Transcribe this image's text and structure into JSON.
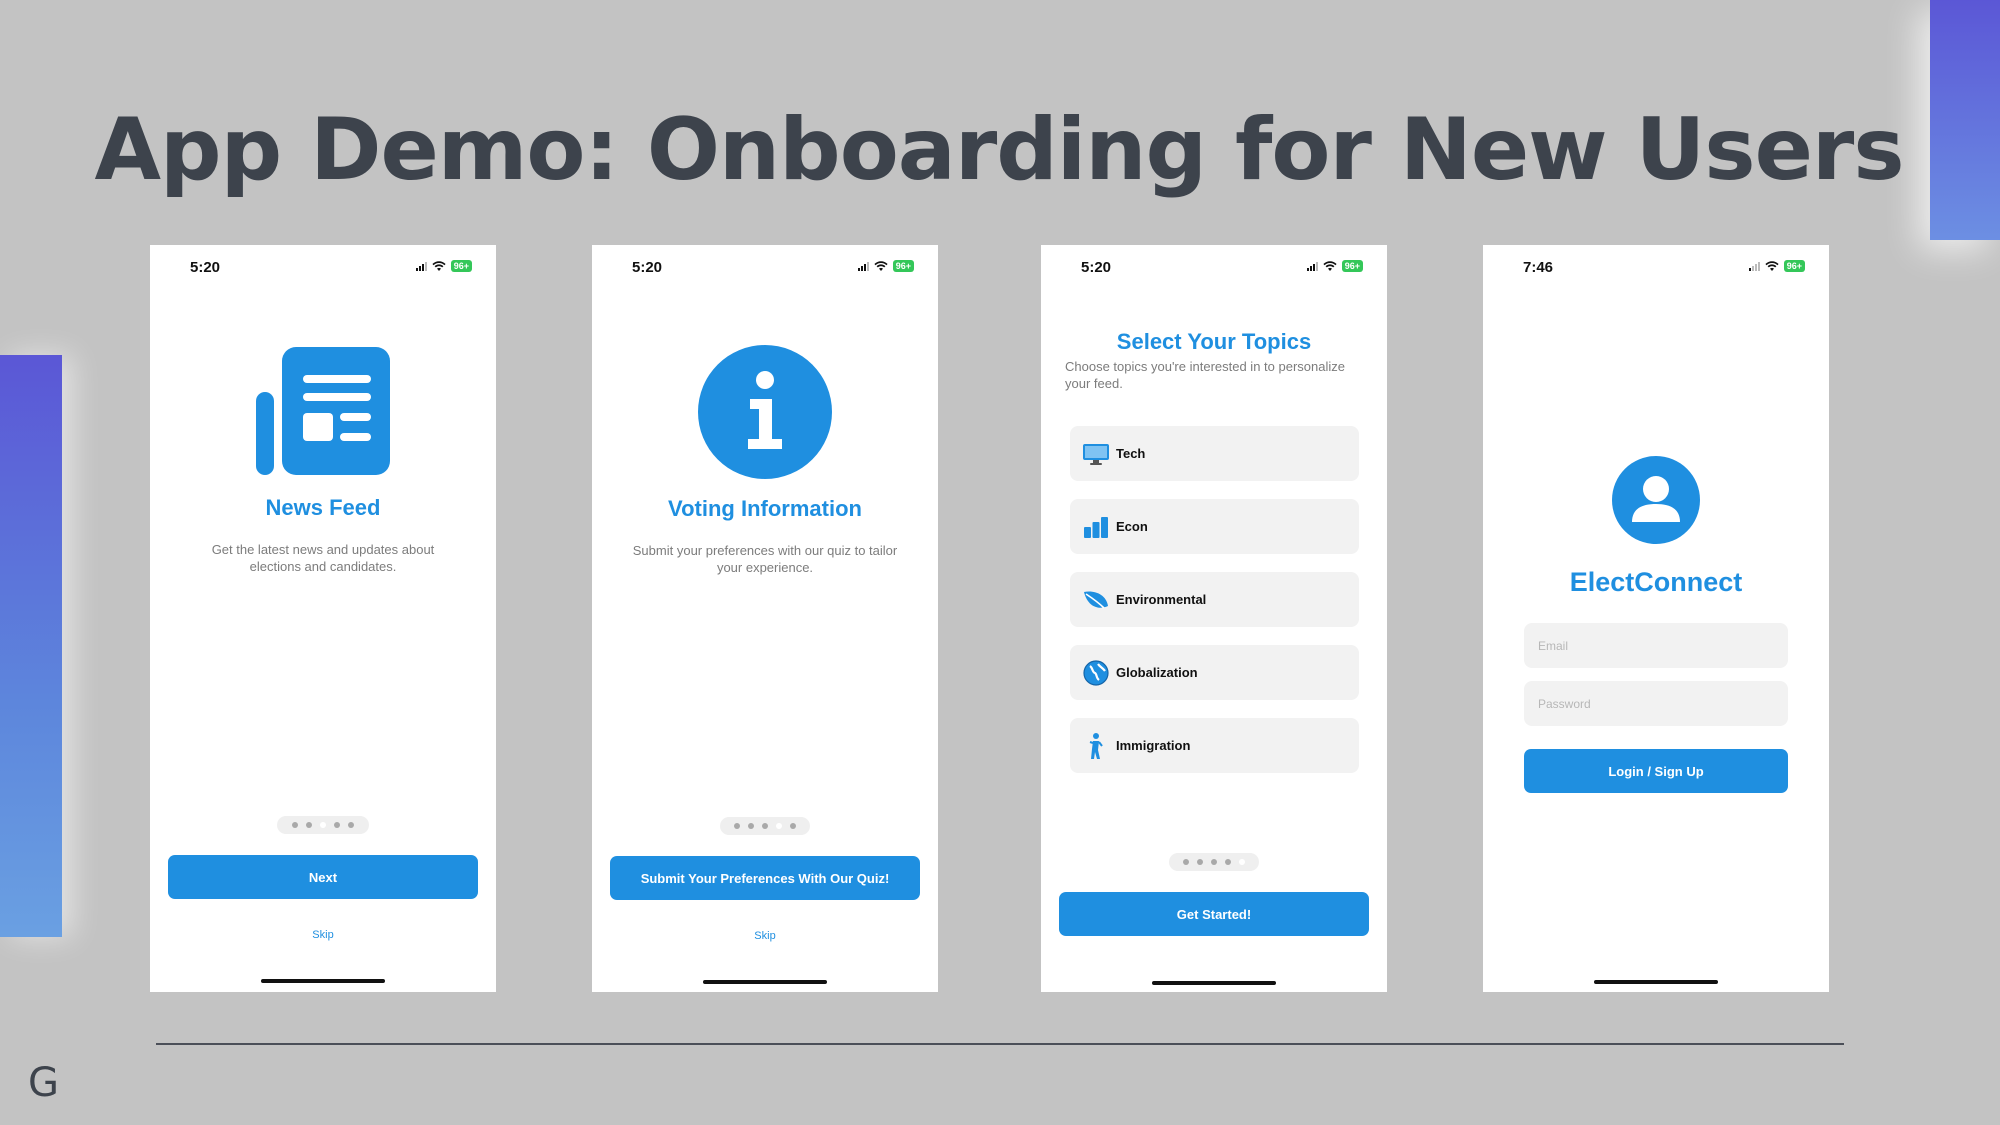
{
  "slide": {
    "title": "App Demo: Onboarding for New Users",
    "logo_letter": "G",
    "accent_color": "#1f8fe0"
  },
  "screens": [
    {
      "status_time": "5:20",
      "battery": "96+",
      "icon": "newspaper-icon",
      "title": "News Feed",
      "description": "Get the latest news and updates about elections and candidates.",
      "button_label": "Next",
      "skip_label": "Skip",
      "page_indicator": {
        "total": 5,
        "active": 3
      }
    },
    {
      "status_time": "5:20",
      "battery": "96+",
      "icon": "info-circle-icon",
      "title": "Voting Information",
      "description": "Submit your preferences with our quiz to tailor your experience.",
      "button_label": "Submit Your Preferences With Our Quiz!",
      "skip_label": "Skip",
      "page_indicator": {
        "total": 5,
        "active": 4
      }
    },
    {
      "status_time": "5:20",
      "battery": "96+",
      "title": "Select Your Topics",
      "description": "Choose topics you're interested in to personalize your feed.",
      "topics": [
        {
          "label": "Tech",
          "icon": "desktop-computer-icon"
        },
        {
          "label": "Econ",
          "icon": "bar-chart-icon"
        },
        {
          "label": "Environmental",
          "icon": "leaf-icon"
        },
        {
          "label": "Globalization",
          "icon": "globe-icon"
        },
        {
          "label": "Immigration",
          "icon": "person-walking-icon"
        }
      ],
      "button_label": "Get Started!",
      "page_indicator": {
        "total": 5,
        "active": 5
      }
    },
    {
      "status_time": "7:46",
      "battery": "96+",
      "icon": "user-avatar-icon",
      "title": "ElectConnect",
      "email_placeholder": "Email",
      "password_placeholder": "Password",
      "button_label": "Login / Sign Up"
    }
  ]
}
